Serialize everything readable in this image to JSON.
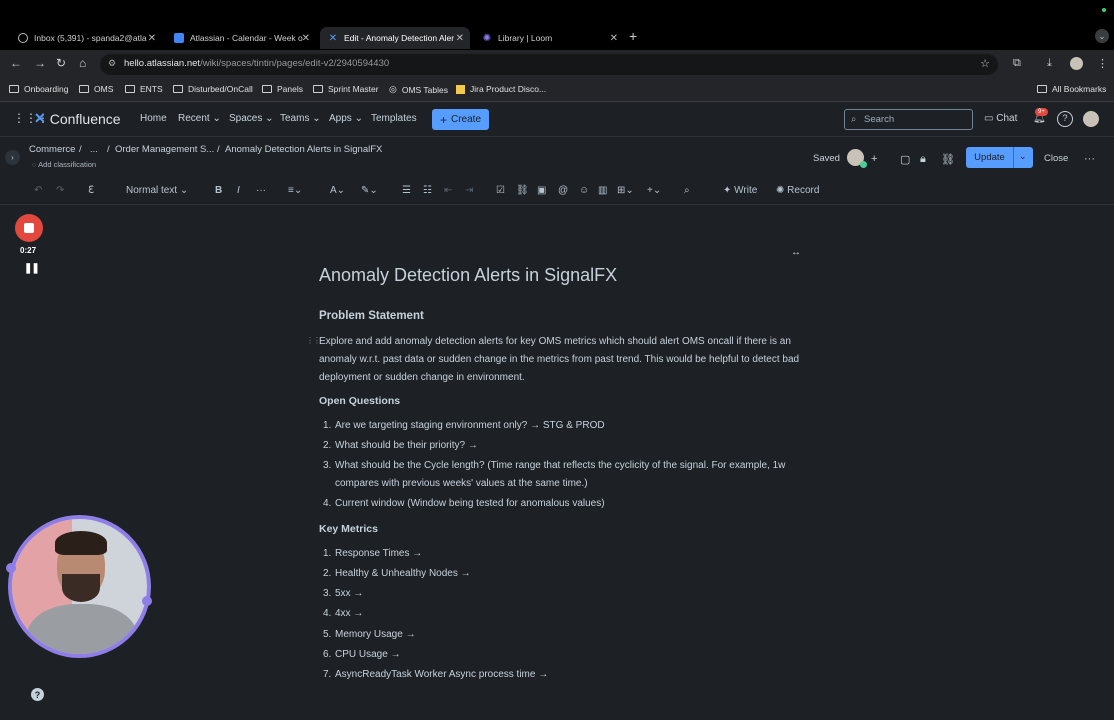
{
  "browser": {
    "tabs": [
      {
        "label": "Inbox (5,391) - spanda2@atla",
        "icon": "mail-icon"
      },
      {
        "label": "Atlassian - Calendar - Week o",
        "icon": "calendar-icon"
      },
      {
        "label": "Edit - Anomaly Detection Aler",
        "icon": "confluence-icon"
      },
      {
        "label": "Library | Loom",
        "icon": "loom-icon"
      }
    ],
    "url_host": "hello.atlassian.net",
    "url_path": "/wiki/spaces/tintin/pages/edit-v2/2940594430",
    "bookmarks": [
      "Onboarding",
      "OMS",
      "ENTS",
      "Disturbed/OnCall",
      "Panels",
      "Sprint Master",
      "OMS Tables",
      "Jira Product Disco..."
    ],
    "all_bookmarks": "All Bookmarks"
  },
  "topnav": {
    "product": "Confluence",
    "items": [
      "Home",
      "Recent",
      "Spaces",
      "Teams",
      "Apps",
      "Templates"
    ],
    "create": "Create",
    "search_placeholder": "Search",
    "chat": "Chat",
    "notif_badge": "9+"
  },
  "breadcrumb": {
    "items": [
      "Commerce",
      "...",
      "Order Management S...",
      "Anomaly Detection Alerts in SignalFX"
    ],
    "classification": "Add classification"
  },
  "editor_actions": {
    "saved": "Saved",
    "update": "Update",
    "close": "Close"
  },
  "toolbar": {
    "text_style": "Normal text",
    "write": "Write",
    "record": "Record"
  },
  "recorder": {
    "time": "0:27"
  },
  "page": {
    "title": "Anomaly Detection Alerts in SignalFX",
    "problem_heading": "Problem Statement",
    "problem_text": "Explore and add anomaly detection alerts for key OMS metrics which should alert OMS oncall if there is an anomaly w.r.t. past data or sudden change in the metrics from past trend. This would be helpful to detect bad deployment or sudden change in environment.",
    "questions_heading": "Open Questions",
    "questions": [
      "Are we targeting staging environment only? → STG & PROD",
      "What should be their priority? →",
      "What should be the Cycle length? (Time range that reflects the cyclicity of the signal. For example, 1w compares with previous weeks' values at the same time.)",
      "Current window (Window being tested for anomalous values)"
    ],
    "metrics_heading": "Key Metrics",
    "metrics": [
      "Response Times →",
      "Healthy & Unhealthy Nodes →",
      "5xx →",
      "4xx →",
      "Memory Usage →",
      "CPU Usage →",
      "AsyncReadyTask Worker Async process time →"
    ]
  }
}
